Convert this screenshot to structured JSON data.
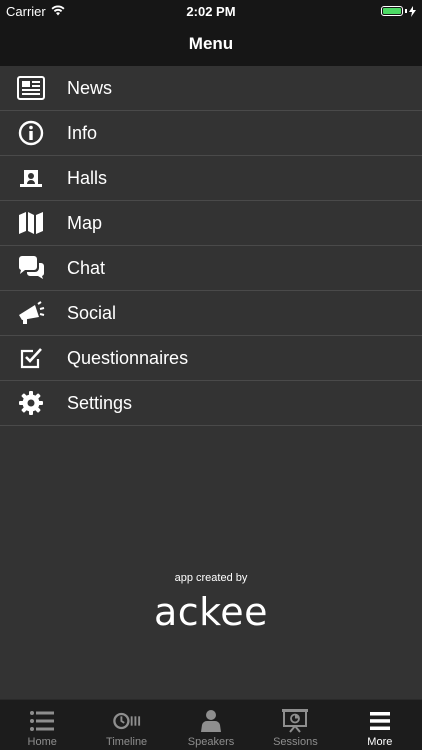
{
  "status_bar": {
    "carrier": "Carrier",
    "time": "2:02 PM",
    "battery_level": 1.0,
    "battery_color": "#4cd964"
  },
  "nav": {
    "title": "Menu"
  },
  "menu": {
    "items": [
      {
        "label": "News",
        "icon": "newspaper-icon"
      },
      {
        "label": "Info",
        "icon": "info-icon"
      },
      {
        "label": "Halls",
        "icon": "hall-icon"
      },
      {
        "label": "Map",
        "icon": "map-icon"
      },
      {
        "label": "Chat",
        "icon": "chat-bubbles-icon"
      },
      {
        "label": "Social",
        "icon": "megaphone-icon"
      },
      {
        "label": "Questionnaires",
        "icon": "checkbox-icon"
      },
      {
        "label": "Settings",
        "icon": "gear-icon"
      }
    ]
  },
  "credits": {
    "caption": "app created by",
    "logo": "ackee"
  },
  "tab_bar": {
    "tabs": [
      {
        "label": "Home",
        "icon": "list-icon",
        "active": false
      },
      {
        "label": "Timeline",
        "icon": "timeline-icon",
        "active": false
      },
      {
        "label": "Speakers",
        "icon": "speaker-person-icon",
        "active": false
      },
      {
        "label": "Sessions",
        "icon": "presentation-icon",
        "active": false
      },
      {
        "label": "More",
        "icon": "hamburger-icon",
        "active": true
      }
    ]
  },
  "colors": {
    "background": "#333333",
    "bar": "#161616",
    "divider": "#4a4a4a",
    "inactive_tab": "#8e8e8e"
  }
}
